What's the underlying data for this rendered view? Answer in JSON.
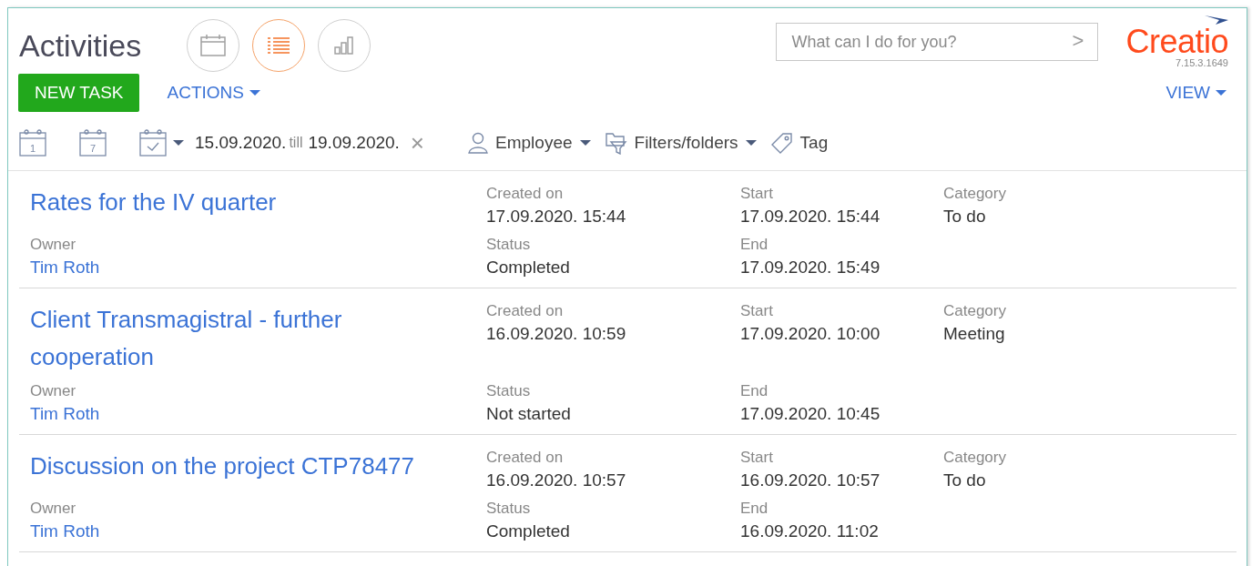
{
  "header": {
    "title": "Activities",
    "view_modes": [
      {
        "kind": "calendar",
        "selected": false
      },
      {
        "kind": "list",
        "selected": true
      },
      {
        "kind": "chart",
        "selected": false
      }
    ],
    "search": {
      "placeholder": "What can I do for you?",
      "arrow": ">"
    },
    "logo": {
      "name": "Creatio",
      "version": "7.15.3.1649"
    }
  },
  "toolbar": {
    "new_task": "NEW TASK",
    "actions": "ACTIONS",
    "view": "VIEW"
  },
  "filter_bar": {
    "date_buttons": [
      {
        "kind": "day",
        "label": "1"
      },
      {
        "kind": "week",
        "label": "7"
      },
      {
        "kind": "period"
      }
    ],
    "period": {
      "from": "15.09.2020.",
      "till": "till",
      "to": "19.09.2020.",
      "clear": "×"
    },
    "filters": [
      {
        "kind": "employee",
        "label": "Employee",
        "dropdown": true
      },
      {
        "kind": "folders",
        "label": "Filters/folders",
        "dropdown": true
      },
      {
        "kind": "tag",
        "label": "Tag",
        "dropdown": false
      }
    ]
  },
  "rows": [
    {
      "title": "Rates for the IV quarter",
      "owner_label": "Owner",
      "owner": "Tim Roth",
      "created_label": "Created on",
      "created": "17.09.2020. 15:44",
      "status_label": "Status",
      "status": "Completed",
      "start_label": "Start",
      "start": "17.09.2020. 15:44",
      "end_label": "End",
      "end": "17.09.2020. 15:49",
      "category_label": "Category",
      "category": "To do"
    },
    {
      "title": "Client Transmagistral - further cooperation",
      "owner_label": "Owner",
      "owner": "Tim Roth",
      "created_label": "Created on",
      "created": "16.09.2020. 10:59",
      "status_label": "Status",
      "status": "Not started",
      "start_label": "Start",
      "start": "17.09.2020. 10:00",
      "end_label": "End",
      "end": "17.09.2020. 10:45",
      "category_label": "Category",
      "category": "Meeting"
    },
    {
      "title": "Discussion on the project CTP78477",
      "owner_label": "Owner",
      "owner": "Tim Roth",
      "created_label": "Created on",
      "created": "16.09.2020. 10:57",
      "status_label": "Status",
      "status": "Completed",
      "start_label": "Start",
      "start": "16.09.2020. 10:57",
      "end_label": "End",
      "end": "16.09.2020. 11:02",
      "category_label": "Category",
      "category": "To do"
    }
  ]
}
